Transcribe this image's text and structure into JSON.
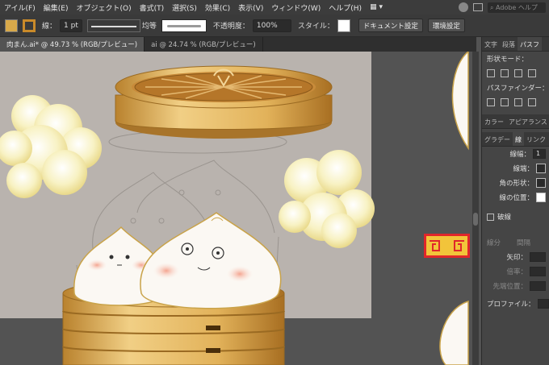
{
  "menubar": {
    "items": [
      "アイル(F)",
      "編集(E)",
      "オブジェクト(O)",
      "書式(T)",
      "選択(S)",
      "効果(C)",
      "表示(V)",
      "ウィンドウ(W)",
      "ヘルプ(H)"
    ],
    "search_placeholder": "Adobe ヘルプ"
  },
  "controlbar": {
    "stroke_label": "線：",
    "stroke_weight": "1 pt",
    "profile_label": "均等",
    "opacity_label": "不透明度：",
    "opacity_value": "100%",
    "style_label": "スタイル：",
    "document_setup_button": "ドキュメント設定",
    "preferences_button": "環境設定"
  },
  "tabs": [
    {
      "label": "肉まん.ai* @ 49.73 % (RGB/プレビュー)",
      "active": true
    },
    {
      "label": "ai @ 24.74 % (RGB/プレビュー)",
      "active": false
    }
  ],
  "panels": {
    "top_tabs": [
      "文字",
      "段落",
      "パスフ"
    ],
    "shape_modes_label": "形状モード：",
    "pathfinder_label": "パスファインダー：",
    "mid_tabs": [
      "カラー",
      "アピアランス"
    ],
    "stroke_tabs": [
      "グラデー",
      "線",
      "リンク"
    ],
    "stroke_weight_label": "線幅：",
    "stroke_weight_value": "1",
    "cap_label": "線端：",
    "corner_label": "角の形状：",
    "align_label": "線の位置：",
    "dashed_label": "破線",
    "dash_label": "線分",
    "gap_label": "間隔",
    "arrow_label": "矢印：",
    "scale_label": "倍率：",
    "tip_label": "先端位置：",
    "profile_label": "プロファイル："
  },
  "colors": {
    "menubar_bg": "#3c3c3c",
    "workspace_bg": "#535353",
    "artboard_bg": "#b9b3ae",
    "bamboo_gold": "#d8a94a",
    "bun_white": "#fbf8f3",
    "steam_yellow": "#f7f0b8",
    "pattern_red": "#e0262b"
  }
}
